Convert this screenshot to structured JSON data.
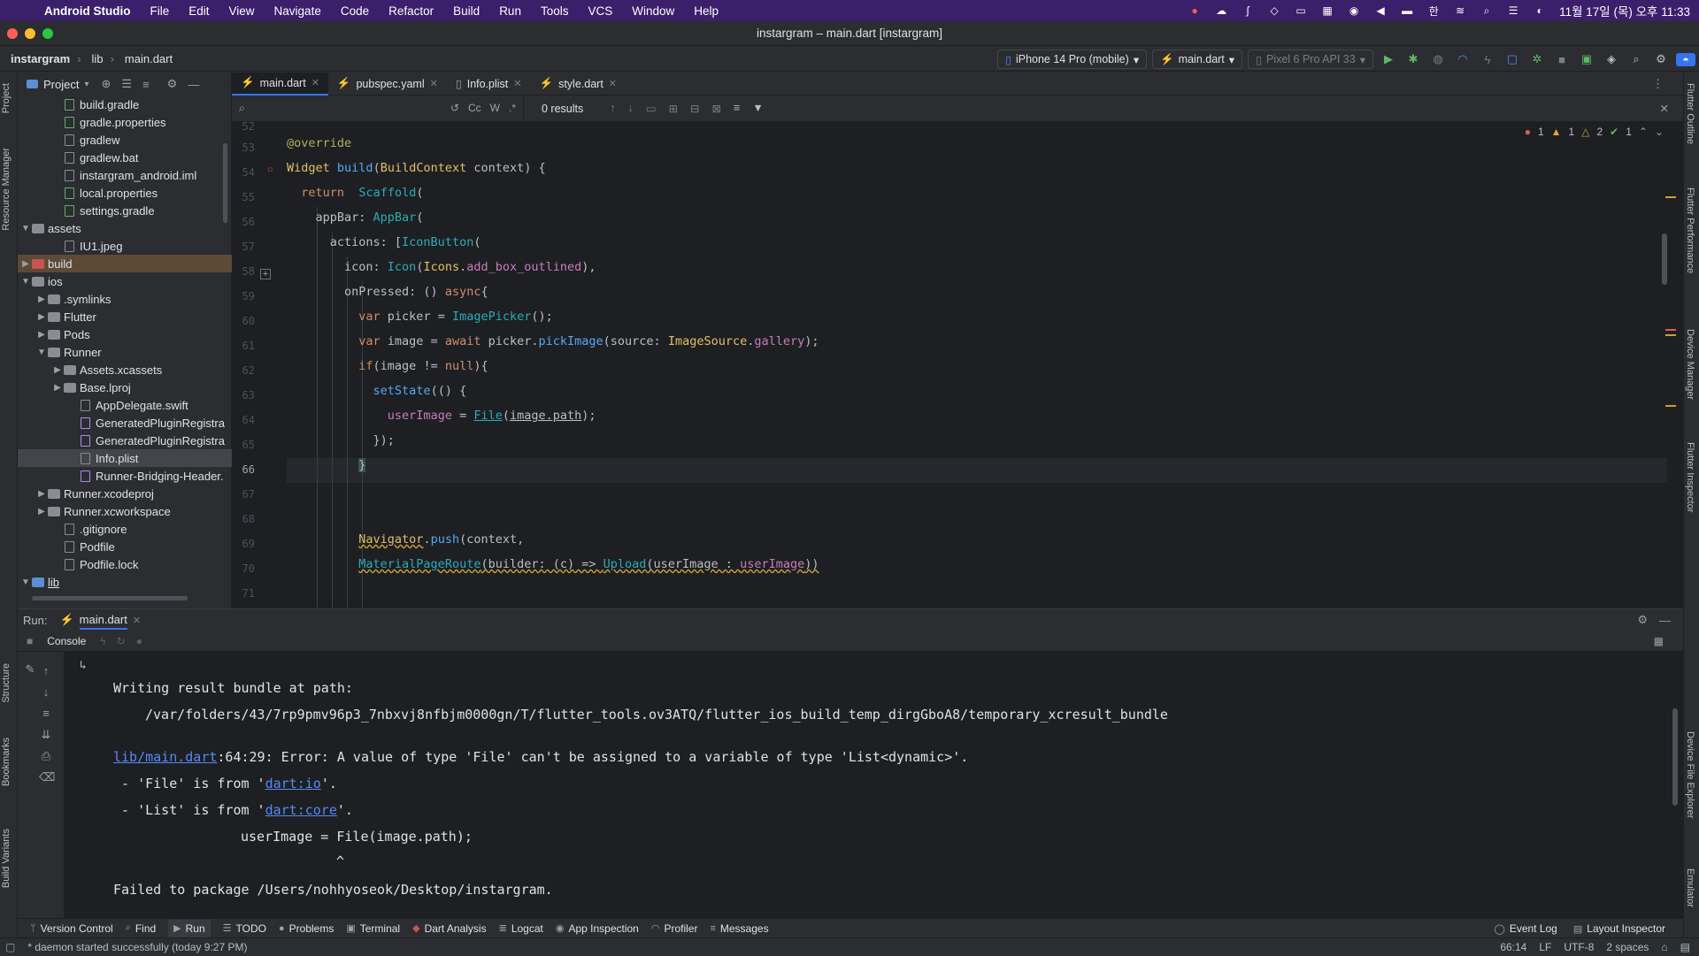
{
  "menubar": {
    "app_name": "Android Studio",
    "items": [
      "File",
      "Edit",
      "View",
      "Navigate",
      "Code",
      "Refactor",
      "Build",
      "Run",
      "Tools",
      "VCS",
      "Window",
      "Help"
    ],
    "clock": "11월 17일 (목) 오후 11:33"
  },
  "window": {
    "title": "instargram – main.dart [instargram]"
  },
  "breadcrumb": {
    "project": "instargram",
    "folder": "lib",
    "file": "main.dart"
  },
  "toolbar": {
    "device": "iPhone 14 Pro (mobile)",
    "run_config": "main.dart",
    "emulator": "Pixel 6 Pro API 33"
  },
  "project_panel": {
    "title": "Project",
    "tree": [
      {
        "label": "build.gradle",
        "depth": 2,
        "kind": "file-g"
      },
      {
        "label": "gradle.properties",
        "depth": 2,
        "kind": "file-g"
      },
      {
        "label": "gradlew",
        "depth": 2,
        "kind": "file"
      },
      {
        "label": "gradlew.bat",
        "depth": 2,
        "kind": "file"
      },
      {
        "label": "instargram_android.iml",
        "depth": 2,
        "kind": "file"
      },
      {
        "label": "local.properties",
        "depth": 2,
        "kind": "file-g"
      },
      {
        "label": "settings.gradle",
        "depth": 2,
        "kind": "file-g"
      },
      {
        "label": "assets",
        "depth": 0,
        "kind": "folder",
        "open": true
      },
      {
        "label": "IU1.jpeg",
        "depth": 2,
        "kind": "file"
      },
      {
        "label": "build",
        "depth": 0,
        "kind": "folder-red",
        "open": false,
        "highlight": "build"
      },
      {
        "label": "ios",
        "depth": 0,
        "kind": "folder",
        "open": true
      },
      {
        "label": ".symlinks",
        "depth": 1,
        "kind": "folder",
        "open": false
      },
      {
        "label": "Flutter",
        "depth": 1,
        "kind": "folder",
        "open": false
      },
      {
        "label": "Pods",
        "depth": 1,
        "kind": "folder",
        "open": false
      },
      {
        "label": "Runner",
        "depth": 1,
        "kind": "folder",
        "open": true
      },
      {
        "label": "Assets.xcassets",
        "depth": 2,
        "kind": "folder",
        "open": false
      },
      {
        "label": "Base.lproj",
        "depth": 2,
        "kind": "folder",
        "open": false
      },
      {
        "label": "AppDelegate.swift",
        "depth": 3,
        "kind": "file"
      },
      {
        "label": "GeneratedPluginRegistra",
        "depth": 3,
        "kind": "file-p"
      },
      {
        "label": "GeneratedPluginRegistra",
        "depth": 3,
        "kind": "file-p"
      },
      {
        "label": "Info.plist",
        "depth": 3,
        "kind": "file",
        "highlight": "sel"
      },
      {
        "label": "Runner-Bridging-Header.",
        "depth": 3,
        "kind": "file-p"
      },
      {
        "label": "Runner.xcodeproj",
        "depth": 1,
        "kind": "folder",
        "open": false
      },
      {
        "label": "Runner.xcworkspace",
        "depth": 1,
        "kind": "folder",
        "open": false
      },
      {
        "label": ".gitignore",
        "depth": 2,
        "kind": "file"
      },
      {
        "label": "Podfile",
        "depth": 2,
        "kind": "file"
      },
      {
        "label": "Podfile.lock",
        "depth": 2,
        "kind": "file"
      },
      {
        "label": "lib",
        "depth": 0,
        "kind": "folder-blue",
        "open": true,
        "underline": true
      }
    ]
  },
  "tabs": [
    {
      "label": "main.dart",
      "active": true
    },
    {
      "label": "pubspec.yaml",
      "active": false
    },
    {
      "label": "Info.plist",
      "active": false
    },
    {
      "label": "style.dart",
      "active": false
    }
  ],
  "find": {
    "results": "0 results",
    "opt_case": "Cc",
    "opt_word": "W",
    "opt_regex": ".*"
  },
  "inspection": {
    "errors": "1",
    "warnings": "1",
    "weak": "2",
    "ok": "1"
  },
  "code": {
    "lines": [
      "52",
      "53",
      "54",
      "55",
      "56",
      "57",
      "58",
      "59",
      "60",
      "61",
      "62",
      "63",
      "64",
      "65",
      "66",
      "67",
      "68",
      "69",
      "70",
      "71"
    ],
    "current_line": "66"
  },
  "run": {
    "label": "Run:",
    "tab": "main.dart",
    "console_tab": "Console",
    "output": {
      "l1": "Writing result bundle at path:",
      "l2": "/var/folders/43/7rp9pmv96p3_7nbxvj8nfbjm0000gn/T/flutter_tools.ov3ATQ/flutter_ios_build_temp_dirgGboA8/temporary_xcresult_bundle",
      "err_link": "lib/main.dart",
      "err_rest": ":64:29: Error: A value of type 'File' can't be assigned to a variable of type 'List<dynamic>'.",
      "l4a": " - 'File' is from '",
      "l4link": "dart:io",
      "l4b": "'.",
      "l5a": " - 'List' is from '",
      "l5link": "dart:core",
      "l5b": "'.",
      "l6": "userImage = File(image.path);",
      "l7": "^",
      "l8": "Failed to package /Users/nohhyoseok/Desktop/instargram."
    }
  },
  "left_tools": [
    "Project",
    "Resource Manager",
    "Structure",
    "Bookmarks",
    "Build Variants"
  ],
  "right_tools": [
    "Flutter Outline",
    "Flutter Performance",
    "Device Manager",
    "Flutter Inspector",
    "Device File Explorer",
    "Emulator"
  ],
  "tool_windows": [
    "Version Control",
    "Find",
    "Run",
    "TODO",
    "Problems",
    "Terminal",
    "Dart Analysis",
    "Logcat",
    "App Inspection",
    "Profiler",
    "Messages"
  ],
  "tool_windows_right": [
    "Event Log",
    "Layout Inspector"
  ],
  "status": {
    "message": "* daemon started successfully (today 9:27 PM)",
    "position": "66:14",
    "line_sep": "LF",
    "encoding": "UTF-8",
    "indent": "2 spaces"
  },
  "colors": {
    "accent": "#3574f0",
    "menubar": "#3a1f6b",
    "error": "#db5c5c",
    "warning": "#e8a33d",
    "ok": "#5fb865"
  }
}
